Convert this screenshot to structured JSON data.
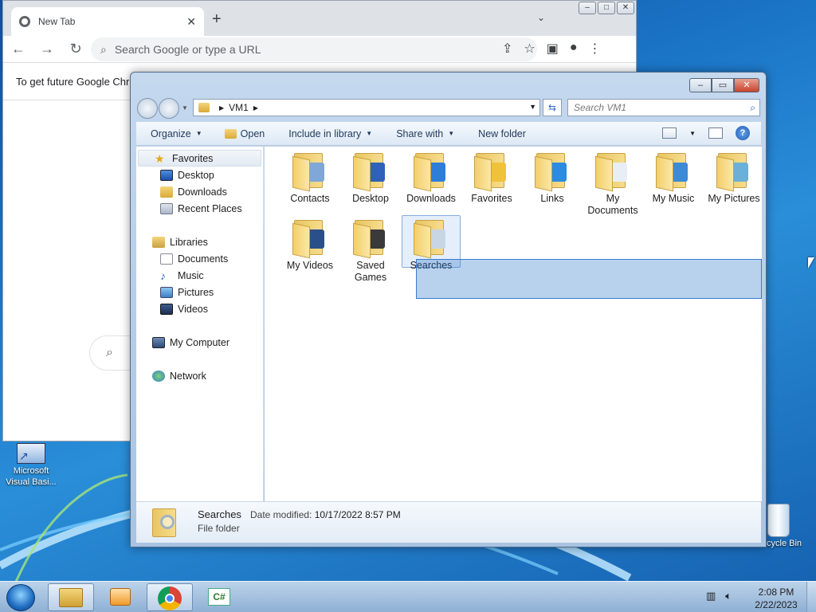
{
  "chrome": {
    "tab_title": "New Tab",
    "tab_close": "✕",
    "new_tab": "+",
    "tab_dropdown": "⌄",
    "omnibox_placeholder": "Search Google or type a URL",
    "banner": "To get future Google Chr"
  },
  "explorer": {
    "address": {
      "crumb": "VM1"
    },
    "search_placeholder": "Search VM1",
    "toolbar": {
      "organize": "Organize",
      "open": "Open",
      "include": "Include in library",
      "share": "Share with",
      "new_folder": "New folder"
    },
    "nav": {
      "favorites": "Favorites",
      "desktop": "Desktop",
      "downloads": "Downloads",
      "recent": "Recent Places",
      "libraries": "Libraries",
      "documents": "Documents",
      "music": "Music",
      "pictures": "Pictures",
      "videos": "Videos",
      "computer": "My Computer",
      "network": "Network"
    },
    "items": [
      {
        "label": "Contacts",
        "badge_color": "#7fa7d8"
      },
      {
        "label": "Desktop",
        "badge_color": "#2f61b8"
      },
      {
        "label": "Downloads",
        "badge_color": "#2d7ed8"
      },
      {
        "label": "Favorites",
        "badge_color": "#f0c23a"
      },
      {
        "label": "Links",
        "badge_color": "#2a8be0"
      },
      {
        "label": "My Documents",
        "badge_color": "#e8eef6"
      },
      {
        "label": "My Music",
        "badge_color": "#3d8ad6"
      },
      {
        "label": "My Pictures",
        "badge_color": "#6bb0d8"
      },
      {
        "label": "My Videos",
        "badge_color": "#2b4f88"
      },
      {
        "label": "Saved Games",
        "badge_color": "#3a3a3a"
      },
      {
        "label": "Searches",
        "badge_color": "#c8d6e4"
      }
    ],
    "details": {
      "name": "Searches",
      "date_label": "Date modified:",
      "date": "10/17/2022 8:57 PM",
      "type": "File folder"
    }
  },
  "desktop": {
    "vb_label": "Microsoft Visual Basi...",
    "recycle_label": "Recycle Bin"
  },
  "taskbar": {
    "time": "2:08 PM",
    "date": "2/22/2023"
  }
}
